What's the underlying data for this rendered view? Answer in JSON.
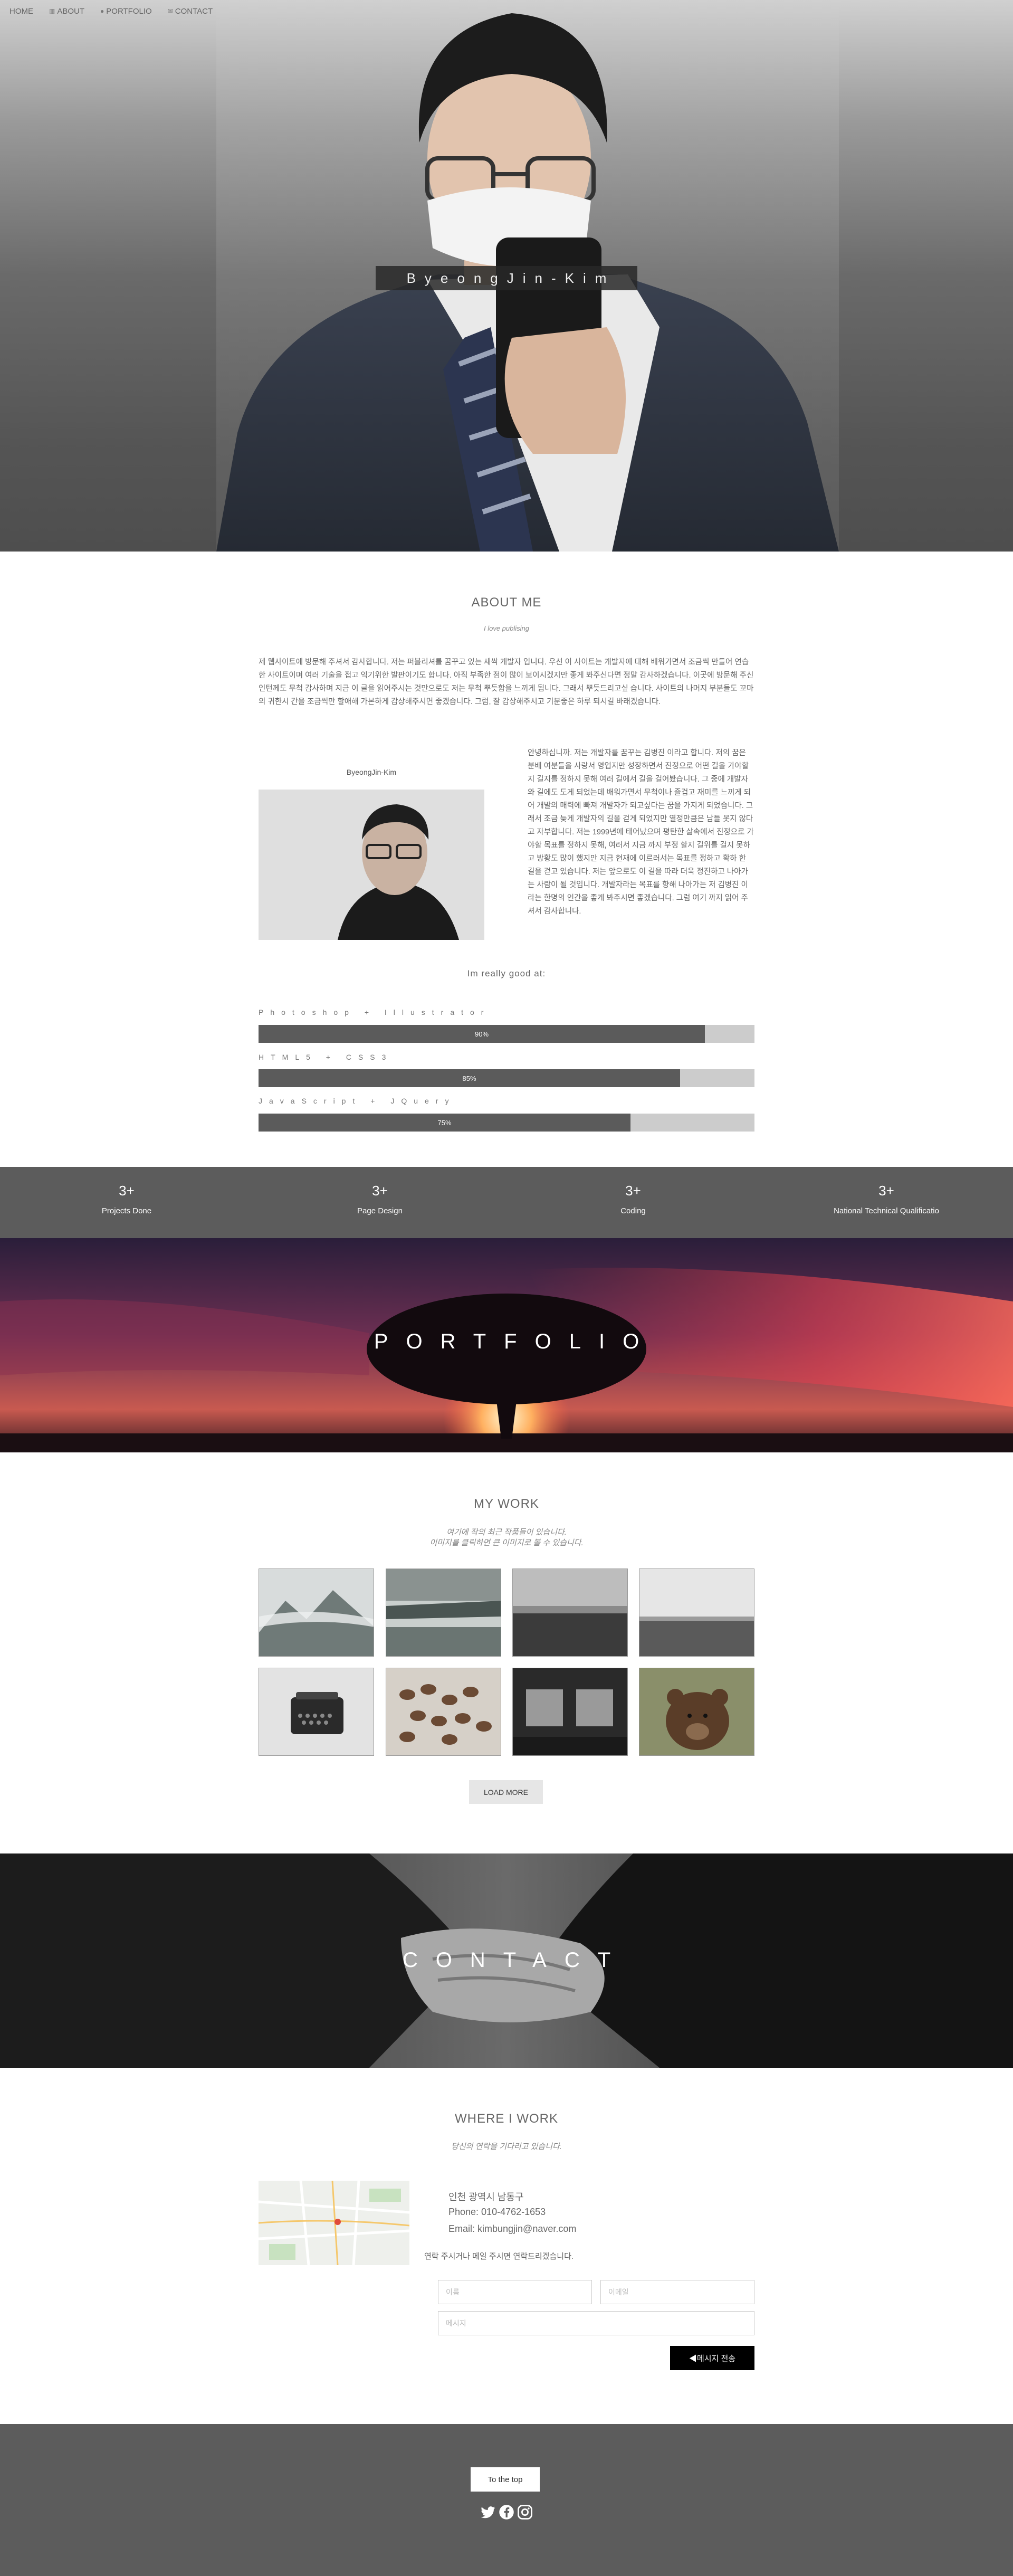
{
  "nav": {
    "items": [
      {
        "label": "HOME",
        "icon": ""
      },
      {
        "label": "ABOUT",
        "icon": "book-icon"
      },
      {
        "label": "PORTFOLIO",
        "icon": "user-icon"
      },
      {
        "label": "CONTACT",
        "icon": "envelope-icon"
      }
    ]
  },
  "hero": {
    "name": "ByeongJin-Kim"
  },
  "about": {
    "title": "ABOUT ME",
    "subtitle": "I love publising",
    "intro": "제 웹사이트에 방문해 주셔서 감사합니다. 저는 퍼블리셔를 꿈꾸고 있는 새싹 개발자 입니다. 우선 이 사이트는 개발자에 대해 배워가면서 조금씩 만들어 연습한 사이트이며 여러 기술을 접고 익기위한 발판이기도 합니다. 아직 부족한 점이 많이 보이시겠지만 좋게 봐주신다면 정말 감사하겠습니다. 이곳에 방문해 주신 인턴께도 무척 감사하며 지금 이 글을 읽어주시는 것만으로도 저는 무척 뿌듯함을 느끼게 됩니다. 그래서 뿌듯드리고싶 습니다. 사이트의 나머지 부분들도 꼬마의 귀한시 간을 조금씩만 할애해 가본하게 감상해주시면 좋겠습니다. 그럼, 잘 감상해주시고 기분좋은 하루 되시길 바래겠습니다.",
    "photo_caption": "ByeongJin-Kim",
    "body": "안녕하십니까. 저는 개발자를 꿈꾸는 김병진 이라고 합니다. 저의 꿈은 분배 여분들을 사랑서 영업지만 성장하면서 진정으로 어떤 길을 가야할지 길지를 정하지 못해 여러 길에서 길을 걸어봤습니다. 그 중에 개발자와 길에도 도게 되었는데 배워가면서 무척이나 즐겁고 재미를 느끼게 되어 개발의 매력에 빠져 개발자가 되고싶다는 꿈을 가지게 되었습니다. 그래서 조금 늦게 개발자의 길을 걷게 되었지만 열정만큼은 남들 못지 않다고 자부합니다. 저는 1999년에 태어났으며 평탄한 삶속에서 진정으로 가야할 목표를 정하지 못해, 여러서 지금 까지 부정 할지 길위를 걸지 못하고 방황도 많이 했지만 지금 현재에 이르러서는 목표를 정하고 확하 한 길을 걷고 있습니다. 저는 앞으로도 이 길을 따라 더욱 정진하고 나아가는 사람이 될 것입니다. 개발자라는 목표를 향해 나아가는 저 김병진 이라는 한명의 인간을 좋게 봐주시면 좋겠습니다. 그럼 여기 까지 읽어 주셔서 감사합니다."
  },
  "skills": {
    "title": "Im really good at:",
    "items": [
      {
        "name": "Photoshop + Illustrator",
        "percent": 90,
        "label": "90%"
      },
      {
        "name": "HTML5 + CSS3",
        "percent": 85,
        "label": "85%"
      },
      {
        "name": "JavaScript + JQuery",
        "percent": 75,
        "label": "75%"
      }
    ]
  },
  "stats": [
    {
      "num": "3+",
      "label": "Projects Done"
    },
    {
      "num": "3+",
      "label": "Page Design"
    },
    {
      "num": "3+",
      "label": "Coding"
    },
    {
      "num": "3+",
      "label": "National Technical Qualificatio"
    }
  ],
  "portfolio": {
    "banner": "PORTFOLIO",
    "title": "MY WORK",
    "subtitle_1": "여기에 작의 최근 작품들이 있습니다.",
    "subtitle_2": "이미지를 클릭하면 큰 이미지로 볼 수 있습니다.",
    "load_more": "LOAD MORE"
  },
  "contact": {
    "banner": "CONTACT",
    "title": "WHERE I WORK",
    "subtitle": "당신의 연락을 기다리고 있습니다.",
    "address": "인천 광역시 남동구",
    "phone": "Phone: 010-4762-1653",
    "email": "Email: kimbungjin@naver.com",
    "note": "연락 주시거나 메일 주시면 연락드리겠습니다.",
    "name_placeholder": "이름",
    "email_placeholder": "이메일",
    "message_placeholder": "메시지",
    "send": "메시지 전송"
  },
  "footer": {
    "top_button": "To the top"
  },
  "colors": {
    "stats_bg": "#5c5c5c",
    "bar_fill": "#5b5b5b",
    "bar_bg": "#cccccc",
    "send_bg": "#000000"
  }
}
